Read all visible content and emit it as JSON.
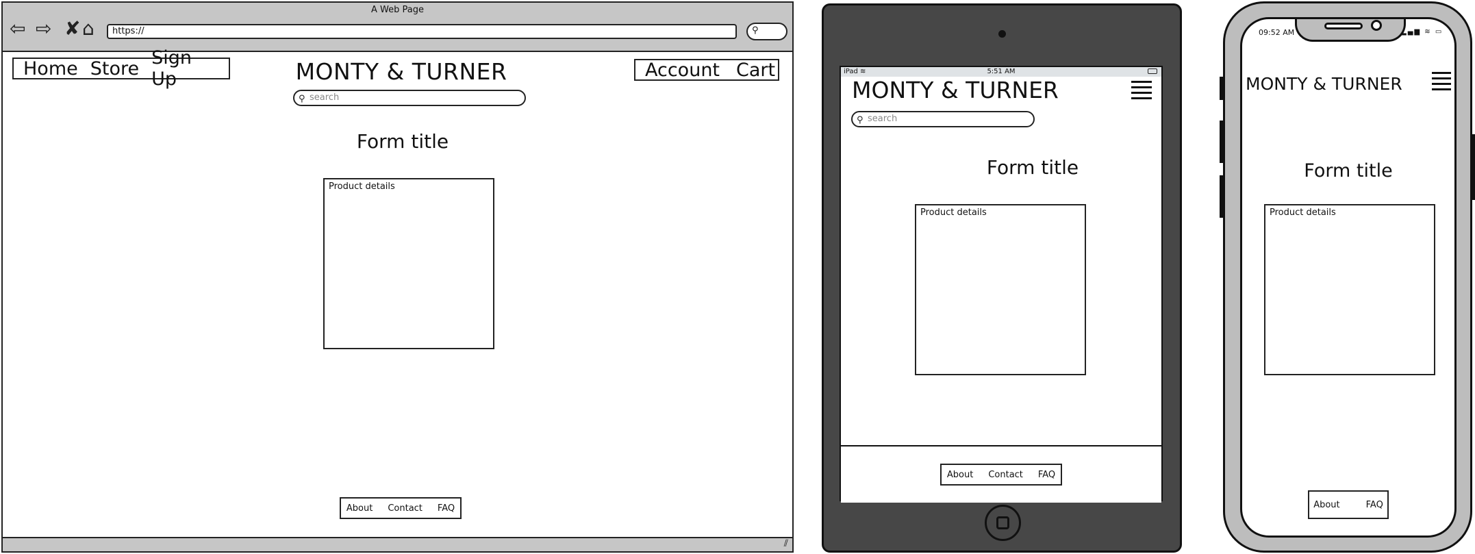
{
  "desktop": {
    "window_title": "A Web Page",
    "url": "https://",
    "nav_left": [
      "Home",
      "Store",
      "Sign Up"
    ],
    "nav_right": [
      "Account",
      "Cart"
    ],
    "brand": "MONTY & TURNER",
    "search_placeholder": "search",
    "form_title": "Form title",
    "product_label": "Product details",
    "footer_links": [
      "About",
      "Contact",
      "FAQ"
    ]
  },
  "ipad": {
    "status_device": "iPad",
    "status_time": "5:51 AM",
    "brand": "MONTY & TURNER",
    "search_placeholder": "search",
    "form_title": "Form title",
    "product_label": "Product details",
    "footer_links": [
      "About",
      "Contact",
      "FAQ"
    ]
  },
  "phone": {
    "status_time": "09:52 AM",
    "brand": "MONTY & TURNER",
    "form_title": "Form title",
    "product_label": "Product details",
    "footer_links": [
      "About",
      "FAQ"
    ]
  }
}
